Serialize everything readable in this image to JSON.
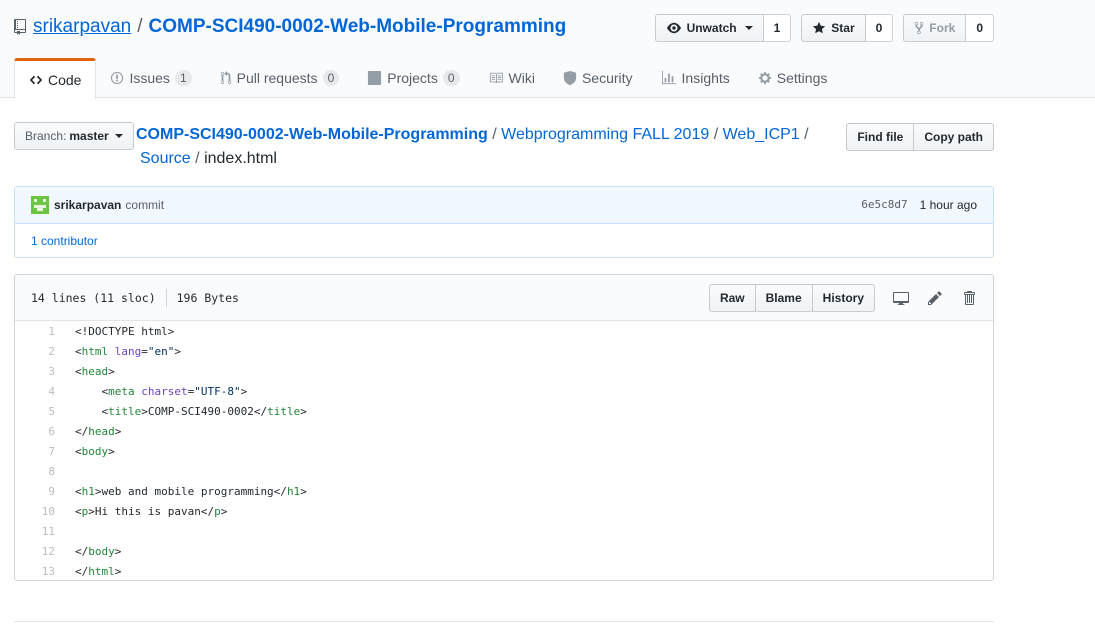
{
  "repo": {
    "owner": "srikarpavan",
    "separator": "/",
    "name": "COMP-SCI490-0002-Web-Mobile-Programming"
  },
  "actions": {
    "watch_label": "Unwatch",
    "watch_count": "1",
    "star_label": "Star",
    "star_count": "0",
    "fork_label": "Fork",
    "fork_count": "0"
  },
  "nav": {
    "code": "Code",
    "issues": "Issues",
    "issues_count": "1",
    "pulls": "Pull requests",
    "pulls_count": "0",
    "projects": "Projects",
    "projects_count": "0",
    "wiki": "Wiki",
    "security": "Security",
    "insights": "Insights",
    "settings": "Settings"
  },
  "branch": {
    "label": "Branch:",
    "value": "master"
  },
  "breadcrumb": {
    "root": "COMP-SCI490-0002-Web-Mobile-Programming",
    "seg1": "Webprogramming FALL 2019",
    "seg2": "Web_ICP1",
    "seg3": "Source",
    "final": "index.html",
    "sep": "/"
  },
  "file_nav": {
    "find_file": "Find file",
    "copy_path": "Copy path"
  },
  "commit": {
    "author": "srikarpavan",
    "message": "commit",
    "sha": "6e5c8d7",
    "time": "1 hour ago",
    "contributors": "1 contributor"
  },
  "file": {
    "lines_info": "14 lines (11 sloc)",
    "size": "196 Bytes",
    "raw": "Raw",
    "blame": "Blame",
    "history": "History"
  },
  "code_lines": [
    {
      "n": "1",
      "text": "<!DOCTYPE html>"
    },
    {
      "n": "2",
      "text": "<html lang=\"en\">"
    },
    {
      "n": "3",
      "text": "<head>"
    },
    {
      "n": "4",
      "text": "    <meta charset=\"UTF-8\">"
    },
    {
      "n": "5",
      "text": "    <title>COMP-SCI490-0002</title>"
    },
    {
      "n": "6",
      "text": "</head>"
    },
    {
      "n": "7",
      "text": "<body>"
    },
    {
      "n": "8",
      "text": ""
    },
    {
      "n": "9",
      "text": "<h1>web and mobile programming</h1>"
    },
    {
      "n": "10",
      "text": "<p>Hi this is pavan</p>"
    },
    {
      "n": "11",
      "text": ""
    },
    {
      "n": "12",
      "text": "</body>"
    },
    {
      "n": "13",
      "text": "</html>"
    }
  ],
  "colors": {
    "link": "#0366d6",
    "tab_accent": "#e36209",
    "tag": "#22863a",
    "attr": "#6f42c1",
    "string": "#032f62"
  }
}
